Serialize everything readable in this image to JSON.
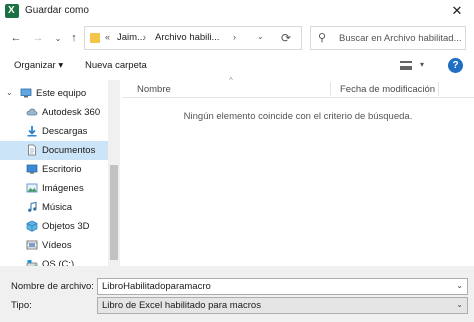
{
  "window": {
    "title": "Guardar como",
    "close_glyph": "✕"
  },
  "navigation": {
    "back_glyph": "←",
    "forward_glyph": "→",
    "recent_glyph": "⌄",
    "up_glyph": "↑"
  },
  "address": {
    "overflow": "«",
    "crumbs": [
      "Jaim...",
      "Archivo habili..."
    ],
    "separator": "›",
    "dropdown_glyph": "⌄",
    "refresh_glyph": "⟳"
  },
  "search": {
    "icon_glyph": "⚲",
    "placeholder": "Buscar en Archivo habilitad..."
  },
  "toolbar": {
    "organize_label": "Organizar ▾",
    "new_folder_label": "Nueva carpeta",
    "view_dropdown_glyph": "▾",
    "help_glyph": "?"
  },
  "nav_pane": {
    "items": [
      {
        "label": "Este equipo",
        "icon": "computer-icon",
        "selected": false
      },
      {
        "label": "Autodesk 360",
        "icon": "cloud-icon",
        "selected": false
      },
      {
        "label": "Descargas",
        "icon": "download-icon",
        "selected": false
      },
      {
        "label": "Documentos",
        "icon": "documents-icon",
        "selected": true
      },
      {
        "label": "Escritorio",
        "icon": "desktop-icon",
        "selected": false
      },
      {
        "label": "Imágenes",
        "icon": "pictures-icon",
        "selected": false
      },
      {
        "label": "Música",
        "icon": "music-icon",
        "selected": false
      },
      {
        "label": "Objetos 3D",
        "icon": "objects-3d-icon",
        "selected": false
      },
      {
        "label": "Vídeos",
        "icon": "videos-icon",
        "selected": false
      },
      {
        "label": "OS (C:)",
        "icon": "drive-icon",
        "selected": false
      }
    ],
    "expand_glyph": "⌄"
  },
  "file_list": {
    "columns": [
      "Nombre",
      "Fecha de modificación"
    ],
    "sort_glyph": "^",
    "empty_message": "Ningún elemento coincide con el criterio de búsqueda."
  },
  "save_form": {
    "filename_label": "Nombre de archivo:",
    "filename_value": "LibroHabilitadoparamacro",
    "type_label": "Tipo:",
    "type_value": "Libro de Excel habilitado para macros",
    "dropdown_glyph": "⌄"
  },
  "colors": {
    "excel_green": "#1d7044",
    "selection_blue": "#cce4f7",
    "help_blue": "#1f6fc5",
    "folder_yellow": "#f3c64b"
  }
}
